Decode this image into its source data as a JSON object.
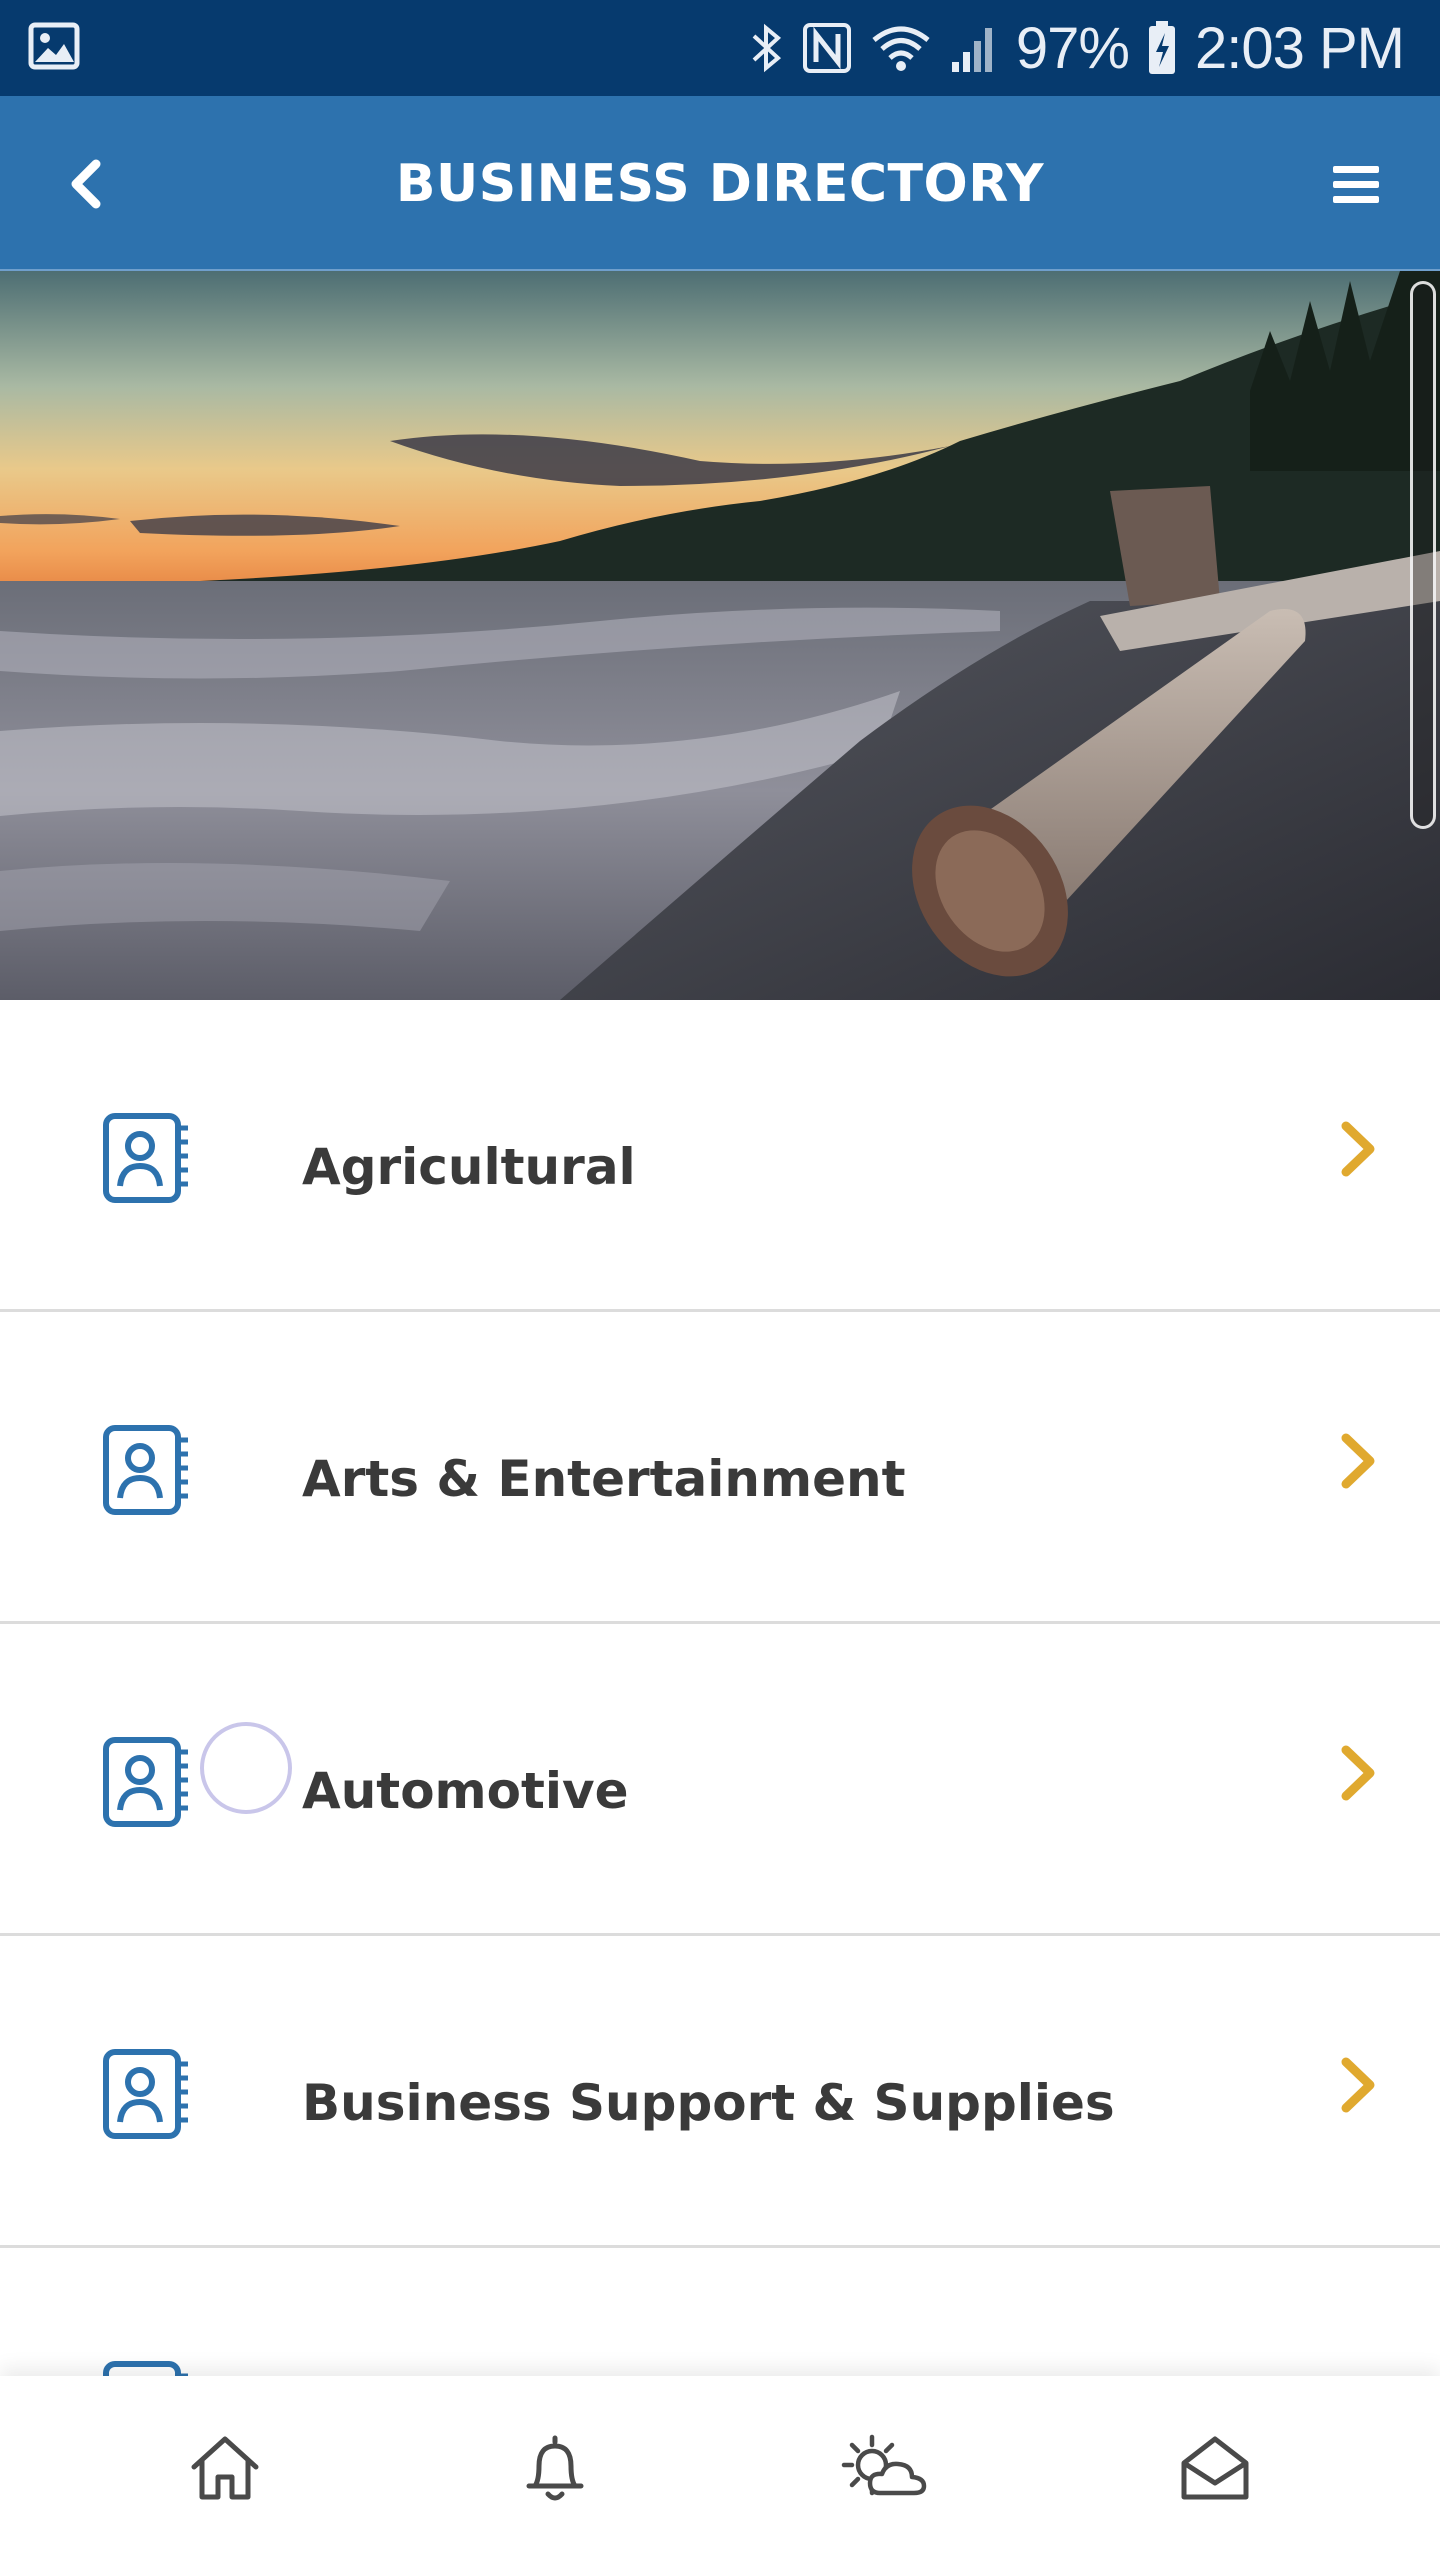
{
  "status_bar": {
    "battery": "97%",
    "time": "2:03 PM",
    "icons": [
      "image-icon",
      "bluetooth-icon",
      "nfc-icon",
      "wifi-icon",
      "signal-icon",
      "battery-charging-icon"
    ]
  },
  "header": {
    "title": "BUSINESS DIRECTORY",
    "back_icon": "chevron-left-icon",
    "menu_icon": "hamburger-menu-icon",
    "background_color": "#2d72ae"
  },
  "hero": {
    "description_icon": "beach-sunset-image"
  },
  "categories": [
    {
      "label": "Agricultural",
      "icon": "contact-book-icon"
    },
    {
      "label": "Arts & Entertainment",
      "icon": "contact-book-icon"
    },
    {
      "label": "Automotive",
      "icon": "contact-book-icon"
    },
    {
      "label": "Business Support & Supplies",
      "icon": "contact-book-icon"
    },
    {
      "label": "",
      "icon": "contact-book-icon"
    }
  ],
  "colors": {
    "accent_chevron": "#e0a92f",
    "icon_blue": "#2d72ae",
    "status_bar": "#063a6e"
  },
  "bottom_nav": [
    {
      "icon": "home-icon"
    },
    {
      "icon": "bell-icon"
    },
    {
      "icon": "weather-icon"
    },
    {
      "icon": "mail-icon"
    }
  ]
}
